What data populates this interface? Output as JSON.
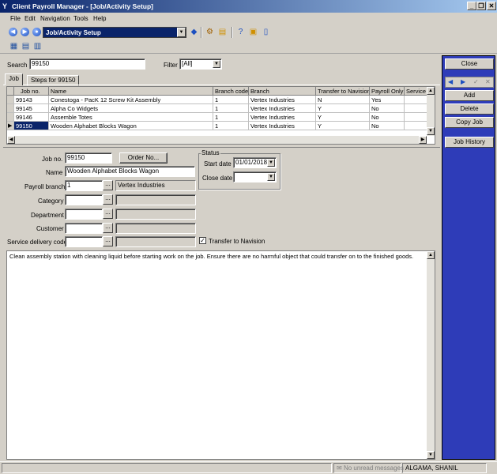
{
  "window": {
    "title": "Client Payroll Manager - [Job/Activity Setup]",
    "minimize": "_",
    "restore": "❐",
    "close": "✕"
  },
  "menu": [
    "File",
    "Edit",
    "Navigation",
    "Tools",
    "Help"
  ],
  "toolbar": {
    "location": "Job/Activity Setup"
  },
  "search": {
    "label": "Search",
    "value": "99150",
    "filter_label": "Filter",
    "filter_value": "[All]"
  },
  "tabs": [
    "Job",
    "Steps for 99150"
  ],
  "grid": {
    "columns": [
      "Job no.",
      "Name",
      "Branch code",
      "Branch",
      "Transfer to Navision",
      "Payroll Only",
      "Service"
    ],
    "rows": [
      {
        "job": "99143",
        "name": "Conestoga - PacK 12 Screw Kit Assembly",
        "branch_code": "1",
        "branch": "Vertex Industries",
        "transfer": "N",
        "payroll": "Yes",
        "service": ""
      },
      {
        "job": "99145",
        "name": "Alpha Co Widgets",
        "branch_code": "1",
        "branch": "Vertex Industries",
        "transfer": "Y",
        "payroll": "No",
        "service": ""
      },
      {
        "job": "99146",
        "name": "Assemble Totes",
        "branch_code": "1",
        "branch": "Vertex Industries",
        "transfer": "Y",
        "payroll": "No",
        "service": ""
      },
      {
        "job": "99150",
        "name": "Wooden Alphabet Blocks Wagon",
        "branch_code": "1",
        "branch": "Vertex Industries",
        "transfer": "Y",
        "payroll": "No",
        "service": ""
      }
    ]
  },
  "form": {
    "job_no_label": "Job no.",
    "job_no": "99150",
    "order_button": "Order No...",
    "name_label": "Name",
    "name": "Wooden Alphabet Blocks Wagon",
    "payroll_branch_label": "Payroll branch",
    "payroll_branch": "1",
    "payroll_branch_name": "Vertex Industries",
    "category_label": "Category",
    "department_label": "Department",
    "customer_label": "Customer",
    "service_delivery_label": "Service delivery code",
    "status_label": "Status",
    "start_date_label": "Start date",
    "start_date": "01/01/2018",
    "close_date_label": "Close date",
    "transfer_label": "Transfer to Navision",
    "transfer_checked": true,
    "notes": "Clean assembly station with cleaning liquid before starting work on the job. Ensure there are no harmful object that could transfer on to the finished goods."
  },
  "side": {
    "close": "Close",
    "add": "Add",
    "delete": "Delete",
    "copy": "Copy Job",
    "history": "Job History"
  },
  "status": {
    "messages": "No unread messages",
    "user": "ALGAMA, SHANIL"
  },
  "colors": {
    "title_start": "#0a246a",
    "title_end": "#a6caf0",
    "side_panel": "#2e3cb8",
    "selection": "#0a246a"
  }
}
